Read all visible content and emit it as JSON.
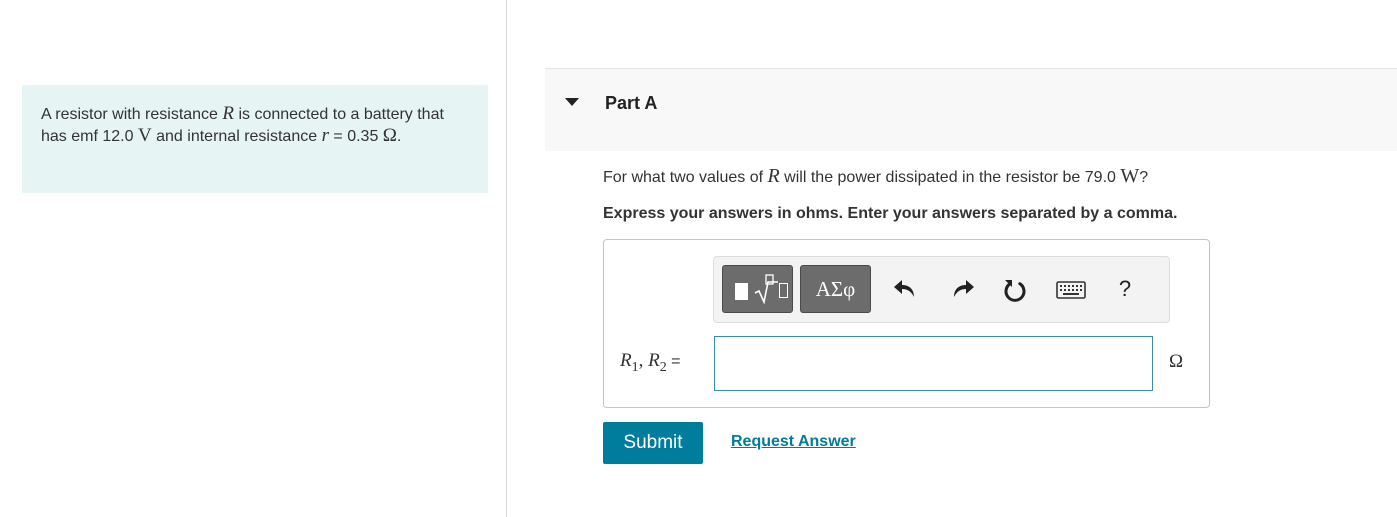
{
  "problem": {
    "text_part1": "A resistor with resistance ",
    "var_R": "R",
    "text_part2": " is connected to a battery that has emf 12.0 ",
    "unit_V": "V",
    "text_part3": " and internal resistance ",
    "var_r": "r",
    "text_part4": " = 0.35 ",
    "unit_ohm": "Ω",
    "text_part5": "."
  },
  "part": {
    "title": "Part A",
    "expanded": true
  },
  "question": {
    "text_part1": "For what two values of ",
    "var_R": "R",
    "text_part2": " will the power dissipated in the resistor be 79.0 ",
    "unit_W": "W",
    "text_part3": "?"
  },
  "instructions": "Express your answers in ohms. Enter your answers separated by a comma.",
  "toolbar": {
    "templates_icon": "templates-icon",
    "symbols_label": "ΑΣφ",
    "undo_icon": "undo-icon",
    "redo_icon": "redo-icon",
    "reset_icon": "reset-icon",
    "keyboard_icon": "keyboard-icon",
    "help_label": "?"
  },
  "answer": {
    "label_R1": "R",
    "label_sub1": "1",
    "label_sep": ", ",
    "label_R2": "R",
    "label_sub2": "2",
    "label_eq": " =",
    "value": "",
    "unit": "Ω"
  },
  "actions": {
    "submit_label": "Submit",
    "request_answer_label": "Request Answer"
  },
  "colors": {
    "problem_bg": "#e7f4f4",
    "accent": "#007c9d",
    "input_border": "#3a8bb3",
    "toolbar_button": "#6c6c6c"
  }
}
